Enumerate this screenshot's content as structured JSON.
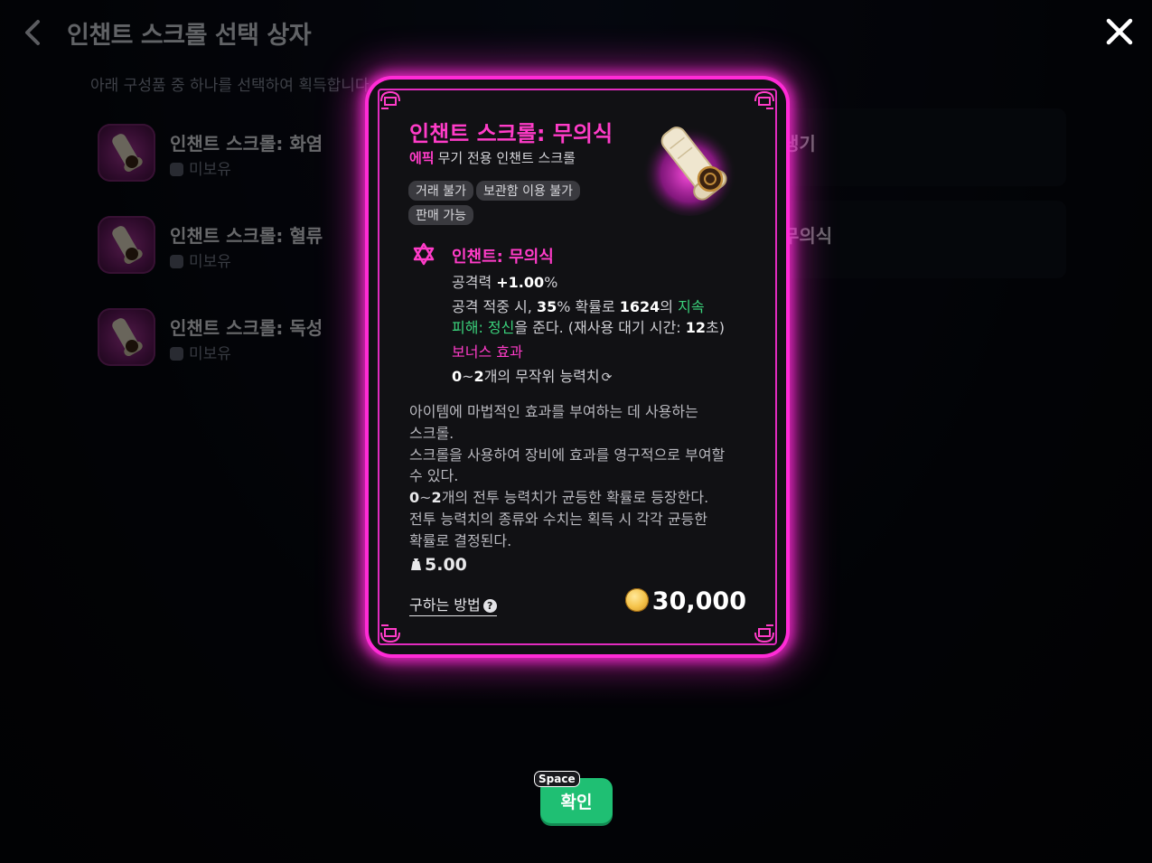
{
  "header": {
    "title": "인챈트 스크롤 선택 상자",
    "subtitle": "아래 구성품 중 하나를 선택하여 획득합니다."
  },
  "items": [
    {
      "name": "인챈트 스크롤: 화염",
      "status": "미보유"
    },
    {
      "name": "인챈트 스크롤: 혈류",
      "status": "미보유"
    },
    {
      "name": "인챈트 스크롤: 독성",
      "status": "미보유"
    }
  ],
  "right_items": [
    {
      "name_fragment": "냉기"
    },
    {
      "name_fragment": "무의식"
    }
  ],
  "tooltip": {
    "title": "인챈트 스크롤: 무의식",
    "rarity": "에픽",
    "type": "무기 전용 인챈트 스크롤",
    "tags": [
      "거래 불가",
      "보관함 이용 불가",
      "판매 가능"
    ],
    "enchant_name": "인챈트: 무의식",
    "stat_label": "공격력 ",
    "stat_value": "+1.00",
    "stat_unit": "%",
    "effect_line1_a": "공격 적중 시, ",
    "effect_line1_b": "35",
    "effect_line1_c": "% 확률로 ",
    "effect_line1_d": "1624",
    "effect_line1_e": "의 ",
    "effect_line1_f": "지속",
    "effect_line2_a": "피해: 정신",
    "effect_line2_b": "을 준다. (재사용 대기 시간: ",
    "effect_line2_c": "12",
    "effect_line2_d": "초)",
    "bonus_title": "보너스 효과",
    "bonus_a": "0",
    "bonus_b": "~",
    "bonus_c": "2",
    "bonus_d": "개의 무작위 능력치",
    "desc_lines": [
      "아이템에 마법적인 효과를 부여하는 데 사용하는",
      "스크롤.",
      "스크롤을 사용하여 장비에 효과를 영구적으로 부여할",
      "수 있다."
    ],
    "desc_bold_a": "0",
    "desc_bold_b": "~",
    "desc_bold_c": "2",
    "desc_line3_rest": "개의 전투 능력치가 균등한 확률로 등장한다.",
    "desc_lines2": [
      "전투 능력치의 종류와 수치는 획득 시 각각 균등한",
      "확률로 결정된다."
    ],
    "weight": "5.00",
    "how_to": "구하는 방법",
    "price": "30,000"
  },
  "confirm": {
    "label": "확인",
    "key": "Space"
  },
  "colors": {
    "accent": "#ff3cc8",
    "glow": "#ff2bd6",
    "green": "#3ad27b",
    "confirm": "#1fbf73"
  }
}
